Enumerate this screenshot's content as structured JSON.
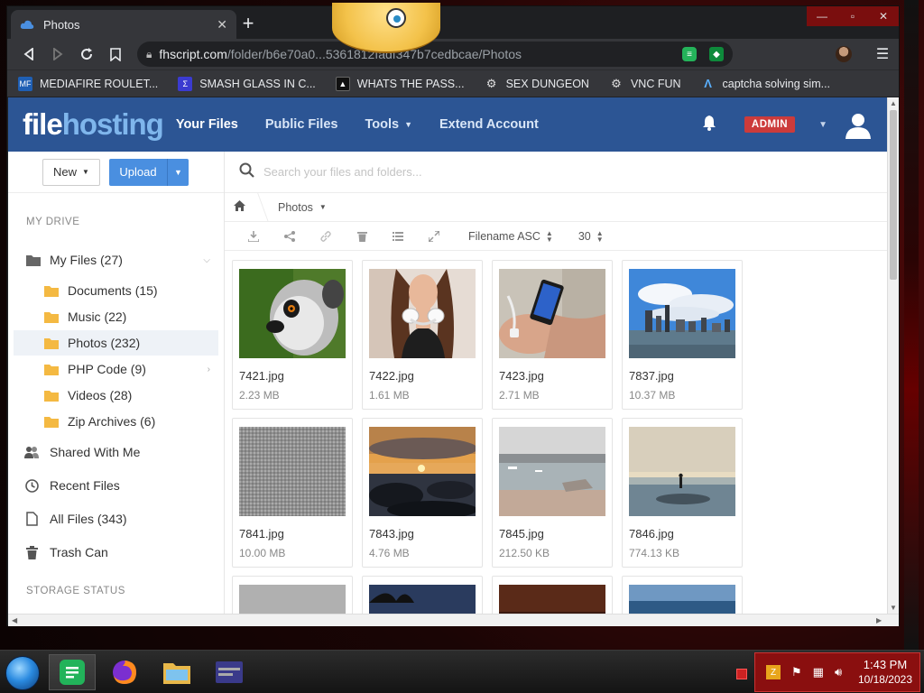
{
  "browser": {
    "tab_title": "Photos",
    "tab_close": "✕",
    "new_tab": "+",
    "url_host": "fhscript.com",
    "url_path": "/folder/b6e70a0...5361812fadf347b7cedbcae/Photos",
    "bookmarks": [
      {
        "label": "MEDIAFIRE ROULET...",
        "icon": "mediafire-icon",
        "color": "#1f5fb4"
      },
      {
        "label": "SMASH GLASS IN C...",
        "icon": "bookmark-icon",
        "color": "#3b3bd0"
      },
      {
        "label": "WHATS THE PASS...",
        "icon": "bookmark-icon",
        "color": "#222222"
      },
      {
        "label": "SEX DUNGEON",
        "icon": "bookmark-icon",
        "color": "#777777"
      },
      {
        "label": "VNC FUN",
        "icon": "bookmark-icon",
        "color": "#777777"
      },
      {
        "label": "captcha solving sim...",
        "icon": "bookmark-icon",
        "color": "#2a7ad0"
      }
    ]
  },
  "site": {
    "logo_file": "file",
    "logo_hosting": "hosting",
    "nav": [
      "Your Files",
      "Public Files",
      "Tools",
      "Extend Account"
    ],
    "admin_badge": "ADMIN",
    "brand_color": "#2c5594"
  },
  "sidebar": {
    "new_label": "New",
    "upload_label": "Upload",
    "section_my_drive": "MY DRIVE",
    "my_files": "My Files (27)",
    "folders": [
      "Documents (15)",
      "Music (22)",
      "Photos (232)",
      "PHP Code (9)",
      "Videos (28)",
      "Zip Archives (6)"
    ],
    "shared": "Shared With Me",
    "recent": "Recent Files",
    "all": "All Files (343)",
    "trash": "Trash Can",
    "section_storage": "STORAGE STATUS"
  },
  "main": {
    "search_placeholder": "Search your files and folders...",
    "breadcrumb": "Photos",
    "sort_label": "Filename ASC",
    "per_page": "30",
    "files": [
      {
        "name": "7421.jpg",
        "size": "2.23 MB"
      },
      {
        "name": "7422.jpg",
        "size": "1.61 MB"
      },
      {
        "name": "7423.jpg",
        "size": "2.71 MB"
      },
      {
        "name": "7837.jpg",
        "size": "10.37 MB"
      },
      {
        "name": "7841.jpg",
        "size": "10.00 MB"
      },
      {
        "name": "7843.jpg",
        "size": "4.76 MB"
      },
      {
        "name": "7845.jpg",
        "size": "212.50 KB"
      },
      {
        "name": "7846.jpg",
        "size": "774.13 KB"
      }
    ]
  },
  "taskbar": {
    "time": "1:43 PM",
    "date": "10/18/2023"
  }
}
